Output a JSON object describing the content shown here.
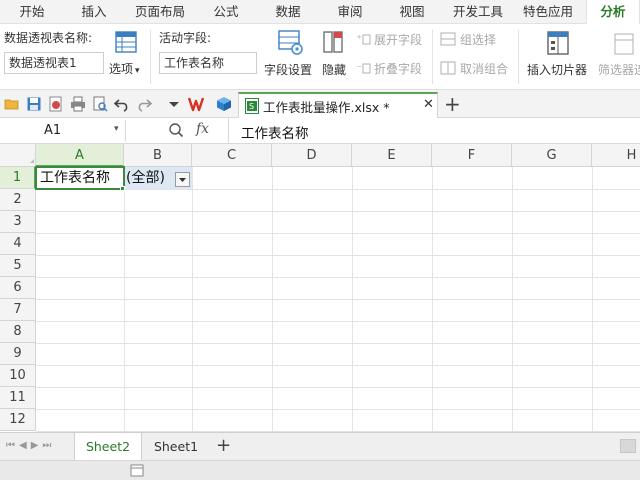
{
  "menu": {
    "tabs": [
      "开始",
      "插入",
      "页面布局",
      "公式",
      "数据",
      "审阅",
      "视图",
      "开发工具",
      "特色应用",
      "分析"
    ],
    "active": "分析"
  },
  "ribbon": {
    "pivot_name_label": "数据透视表名称:",
    "pivot_name_value": "数据透视表1",
    "options_label": "选项",
    "active_field_label": "活动字段:",
    "active_field_value": "工作表名称",
    "field_settings_label": "字段设置",
    "hide_label": "隐藏",
    "expand_field_label": "展开字段",
    "collapse_field_label": "折叠字段",
    "group_selection_label": "组选择",
    "ungroup_label": "取消组合",
    "insert_slicer_label": "插入切片器",
    "filter_connections_label": "筛选器连"
  },
  "document": {
    "tab_title": "工作表批量操作.xlsx *",
    "add_tab_glyph": "+"
  },
  "formula_bar": {
    "cell_ref": "A1",
    "fx_label": "fx",
    "content": "工作表名称"
  },
  "grid": {
    "columns": [
      "A",
      "B",
      "C",
      "D",
      "E",
      "F",
      "G",
      "H"
    ],
    "rows": [
      "1",
      "2",
      "3",
      "4",
      "5",
      "6",
      "7",
      "8",
      "9",
      "10",
      "11",
      "12"
    ],
    "selected_column": "A",
    "selected_row": "1",
    "cells": {
      "A1": "工作表名称",
      "B1": "(全部)"
    }
  },
  "sheets": {
    "tabs": [
      "Sheet2",
      "Sheet1"
    ],
    "active": "Sheet2",
    "add_glyph": "+"
  },
  "colors": {
    "accent_green": "#2a7a2a",
    "selection_green": "#5aa55a",
    "header_bg": "#f4f4f4"
  }
}
